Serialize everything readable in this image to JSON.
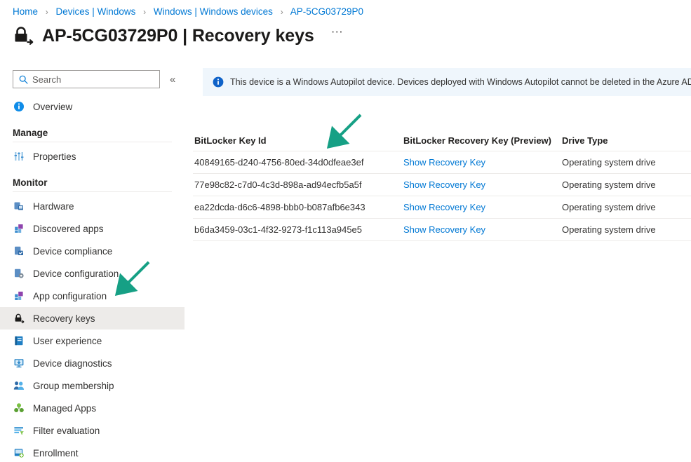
{
  "breadcrumb": {
    "separator": "›",
    "items": [
      {
        "label": "Home"
      },
      {
        "label": "Devices | Windows"
      },
      {
        "label": "Windows | Windows devices"
      },
      {
        "label": "AP-5CG03729P0"
      }
    ]
  },
  "header": {
    "title": "AP-5CG03729P0 | Recovery keys",
    "icon": "bitlocker-key-icon",
    "more_label": "⋯"
  },
  "sidebar": {
    "search": {
      "placeholder": "Search",
      "value": "",
      "icon": "search-icon"
    },
    "collapse": {
      "label": "«",
      "icon": "chevron-double-left-icon"
    },
    "top_items": [
      {
        "label": "Overview",
        "icon": "info-circle-icon",
        "selected": false
      }
    ],
    "groups": [
      {
        "title": "Manage",
        "items": [
          {
            "label": "Properties",
            "icon": "sliders-icon",
            "selected": false
          }
        ]
      },
      {
        "title": "Monitor",
        "items": [
          {
            "label": "Hardware",
            "icon": "hardware-device-icon",
            "selected": false
          },
          {
            "label": "Discovered apps",
            "icon": "discovered-apps-icon",
            "selected": false
          },
          {
            "label": "Device compliance",
            "icon": "device-compliance-icon",
            "selected": false
          },
          {
            "label": "Device configuration",
            "icon": "device-configuration-icon",
            "selected": false
          },
          {
            "label": "App configuration",
            "icon": "app-configuration-icon",
            "selected": false
          },
          {
            "label": "Recovery keys",
            "icon": "recovery-key-icon",
            "selected": true
          },
          {
            "label": "User experience",
            "icon": "user-experience-icon",
            "selected": false
          },
          {
            "label": "Device diagnostics",
            "icon": "device-diagnostics-icon",
            "selected": false
          },
          {
            "label": "Group membership",
            "icon": "group-membership-icon",
            "selected": false
          },
          {
            "label": "Managed Apps",
            "icon": "managed-apps-icon",
            "selected": false
          },
          {
            "label": "Filter evaluation",
            "icon": "filter-evaluation-icon",
            "selected": false
          },
          {
            "label": "Enrollment",
            "icon": "enrollment-icon",
            "selected": false
          }
        ]
      }
    ]
  },
  "main": {
    "banner": {
      "icon": "info-circle-icon",
      "text": "This device is a Windows Autopilot device. Devices deployed with Windows Autopilot cannot be deleted in the Azure AD port"
    },
    "table": {
      "columns": [
        {
          "label": "BitLocker Key Id"
        },
        {
          "label": "BitLocker Recovery Key (Preview)"
        },
        {
          "label": "Drive Type"
        }
      ],
      "rows": [
        {
          "key_id": "40849165-d240-4756-80ed-34d0dfeae3ef",
          "recovery_key_link": "Show Recovery Key",
          "drive_type": "Operating system drive"
        },
        {
          "key_id": "77e98c82-c7d0-4c3d-898a-ad94ecfb5a5f",
          "recovery_key_link": "Show Recovery Key",
          "drive_type": "Operating system drive"
        },
        {
          "key_id": "ea22dcda-d6c6-4898-bbb0-b087afb6e343",
          "recovery_key_link": "Show Recovery Key",
          "drive_type": "Operating system drive"
        },
        {
          "key_id": "b6da3459-03c1-4f32-9273-f1c113a945e5",
          "recovery_key_link": "Show Recovery Key",
          "drive_type": "Operating system drive"
        }
      ]
    }
  },
  "annotations": [
    {
      "name": "arrow-pointing-recovery-keys-nav",
      "color": "#16A085"
    },
    {
      "name": "arrow-pointing-bitlocker-key-id-column",
      "color": "#16A085"
    }
  ],
  "colors": {
    "link": "#0078D4",
    "banner_bg": "#EFF6FC",
    "selected_nav_bg": "#EDEBE9",
    "annotation_green": "#16A085",
    "border": "#EDEBE9"
  }
}
